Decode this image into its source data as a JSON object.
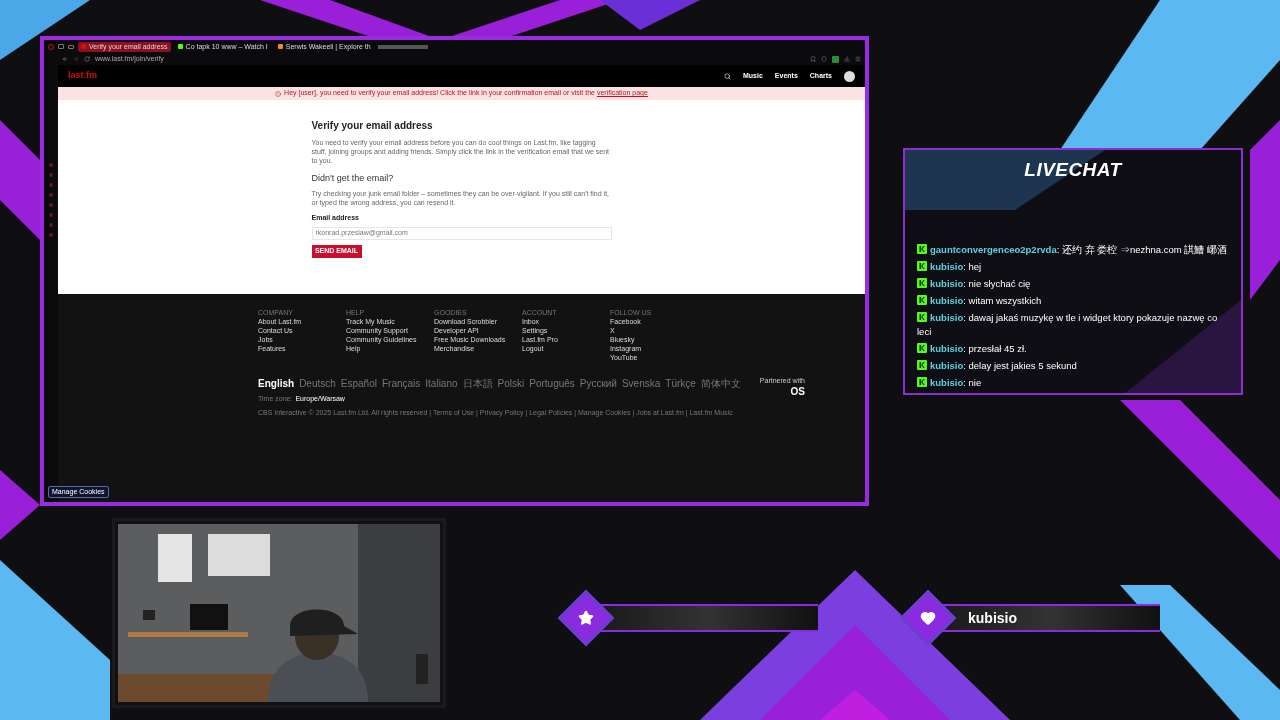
{
  "browser": {
    "tabs": [
      {
        "title": "Verify your email address",
        "color": "#d51007",
        "selected": true
      },
      {
        "title": "Co tapk 10 www – Watch I",
        "color": "#53fc18",
        "selected": false
      },
      {
        "title": "Serwis Wakeeli | Explore th",
        "color": "#f08a24",
        "selected": false
      }
    ],
    "url": "www.last.fm/join/verify",
    "site": {
      "logo": "last.fm",
      "nav": [
        "Music",
        "Events",
        "Charts"
      ]
    },
    "banner": {
      "text": "Hey [user], you need to verify your email address! Click the link in your confirmation email or visit the",
      "link": "verification page"
    },
    "heading": "Verify your email address",
    "intro": "You need to verify your email address before you can do cool things on Last.fm, like tagging stuff, joining groups and adding friends. Simply click the link in the verification email that we sent to you.",
    "subheading": "Didn't get the email?",
    "help": "Try checking your junk email folder – sometimes they can be over-vigilant. If you still can't find it, or typed the wrong address, you can resend it.",
    "email_label": "Email address",
    "email_value": "rkonrad.przeslaw@gmail.com",
    "send_button": "SEND EMAIL",
    "footer": {
      "columns": [
        {
          "title": "COMPANY",
          "links": [
            "About Last.fm",
            "Contact Us",
            "Jobs",
            "Features"
          ]
        },
        {
          "title": "HELP",
          "links": [
            "Track My Music",
            "Community Support",
            "Community Guidelines",
            "Help"
          ]
        },
        {
          "title": "GOODIES",
          "links": [
            "Download Scrobbler",
            "Developer API",
            "Free Music Downloads",
            "Merchandise"
          ]
        },
        {
          "title": "ACCOUNT",
          "links": [
            "Inbox",
            "Settings",
            "Last.fm Pro",
            "Logout"
          ]
        },
        {
          "title": "FOLLOW US",
          "links": [
            "Facebook",
            "X",
            "Bluesky",
            "Instagram",
            "YouTube"
          ]
        }
      ],
      "languages": [
        {
          "label": "English",
          "selected": true
        },
        {
          "label": "Deutsch",
          "selected": false
        },
        {
          "label": "Español",
          "selected": false
        },
        {
          "label": "Français",
          "selected": false
        },
        {
          "label": "Italiano",
          "selected": false
        },
        {
          "label": "日本語",
          "selected": false
        },
        {
          "label": "Polski",
          "selected": false
        },
        {
          "label": "Português",
          "selected": false
        },
        {
          "label": "Русский",
          "selected": false
        },
        {
          "label": "Svenska",
          "selected": false
        },
        {
          "label": "Türkçe",
          "selected": false
        },
        {
          "label": "简体中文",
          "selected": false
        }
      ],
      "timezone_label": "Time zone:",
      "timezone": "Europe/Warsaw",
      "legal": "CBS Interactive © 2025 Last.fm Ltd. All rights reserved | Terms of Use | Privacy Policy | Legal Policies | Manage Cookies | Jobs at Last.fm | Last.fm Music",
      "partner_label": "Partnered with",
      "partner_logo": "OS"
    },
    "cookies_button": "Manage Cookies"
  },
  "livechat": {
    "title": "LIVECHAT",
    "messages": [
      {
        "user": "gauntconvergenceo2p2rvda",
        "text": ": 还约 弃 娄椌 ⇒nezhna.com 諆鰽 峫酒"
      },
      {
        "user": "kubisio",
        "text": ": hej"
      },
      {
        "user": "kubisio",
        "text": ": nie słychać cię"
      },
      {
        "user": "kubisio",
        "text": ": witam wszystkich"
      },
      {
        "user": "kubisio",
        "text": ": dawaj jakaś muzykę w tle i widget ktory pokazuje nazwę co leci"
      },
      {
        "user": "kubisio",
        "text": ": przesłał 45 zł."
      },
      {
        "user": "kubisio",
        "text": ": delay jest jakies 5 sekund"
      },
      {
        "user": "kubisio",
        "text": ": nie"
      }
    ]
  },
  "alerts": [
    {
      "kind": "star"
    },
    {
      "kind": "heart",
      "name": "kubisio"
    }
  ]
}
